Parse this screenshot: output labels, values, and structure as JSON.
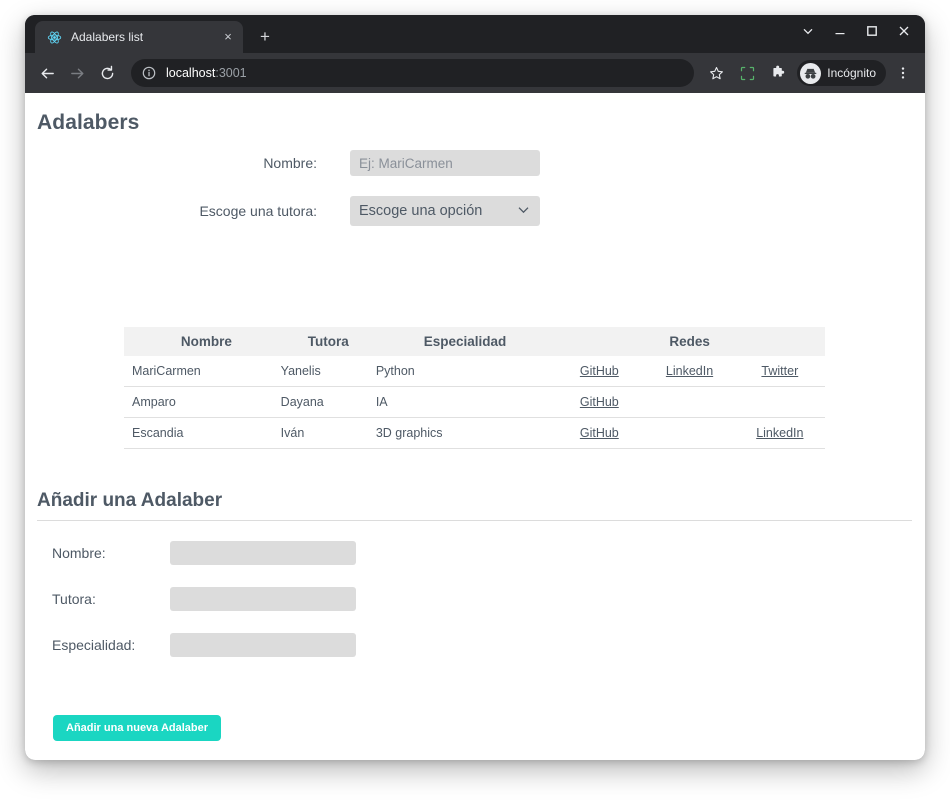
{
  "browser": {
    "tab": {
      "title": "Adalabers list",
      "favicon": "react-logo-icon",
      "close": "×"
    },
    "new_tab": "+",
    "window_controls": {
      "collapse": "⌄",
      "minimize": "—",
      "maximize": "▢",
      "close": "✕"
    },
    "toolbar": {
      "back": "←",
      "forward": "→",
      "reload": "⟳",
      "url_host": "localhost",
      "url_port": ":3001",
      "security_icon": "info-icon",
      "bookmark": "☆",
      "capture": "qr-capture-icon",
      "extensions": "puzzle-icon",
      "incognito_label": "Incógnito",
      "menu": "⋮"
    }
  },
  "page": {
    "title": "Adalabers",
    "filter": {
      "name_label": "Nombre:",
      "name_placeholder": "Ej: MariCarmen",
      "name_value": "",
      "tutor_label": "Escoge una tutora:",
      "tutor_selected": "Escoge una opción",
      "tutor_chevron": "⌄"
    },
    "table": {
      "headers": [
        "Nombre",
        "Tutora",
        "Especialidad",
        "Redes"
      ],
      "rows": [
        {
          "nombre": "MariCarmen",
          "tutora": "Yanelis",
          "especialidad": "Python",
          "redes": [
            "GitHub",
            "LinkedIn",
            "Twitter"
          ]
        },
        {
          "nombre": "Amparo",
          "tutora": "Dayana",
          "especialidad": "IA",
          "redes": [
            "GitHub",
            "",
            ""
          ]
        },
        {
          "nombre": "Escandia",
          "tutora": "Iván",
          "especialidad": "3D graphics",
          "redes": [
            "GitHub",
            "",
            "LinkedIn"
          ]
        }
      ]
    },
    "add_section": {
      "title": "Añadir una Adalaber",
      "fields": [
        {
          "label": "Nombre:",
          "value": ""
        },
        {
          "label": "Tutora:",
          "value": ""
        },
        {
          "label": "Especialidad:",
          "value": ""
        }
      ],
      "submit_label": "Añadir una nueva Adalaber"
    }
  },
  "colors": {
    "accent": "#1ad6c2",
    "text": "#4e5965",
    "input_bg": "#dcdcdc",
    "table_header_bg": "#f2f2f2",
    "chrome_dark": "#202124",
    "chrome_toolbar": "#35363a"
  }
}
